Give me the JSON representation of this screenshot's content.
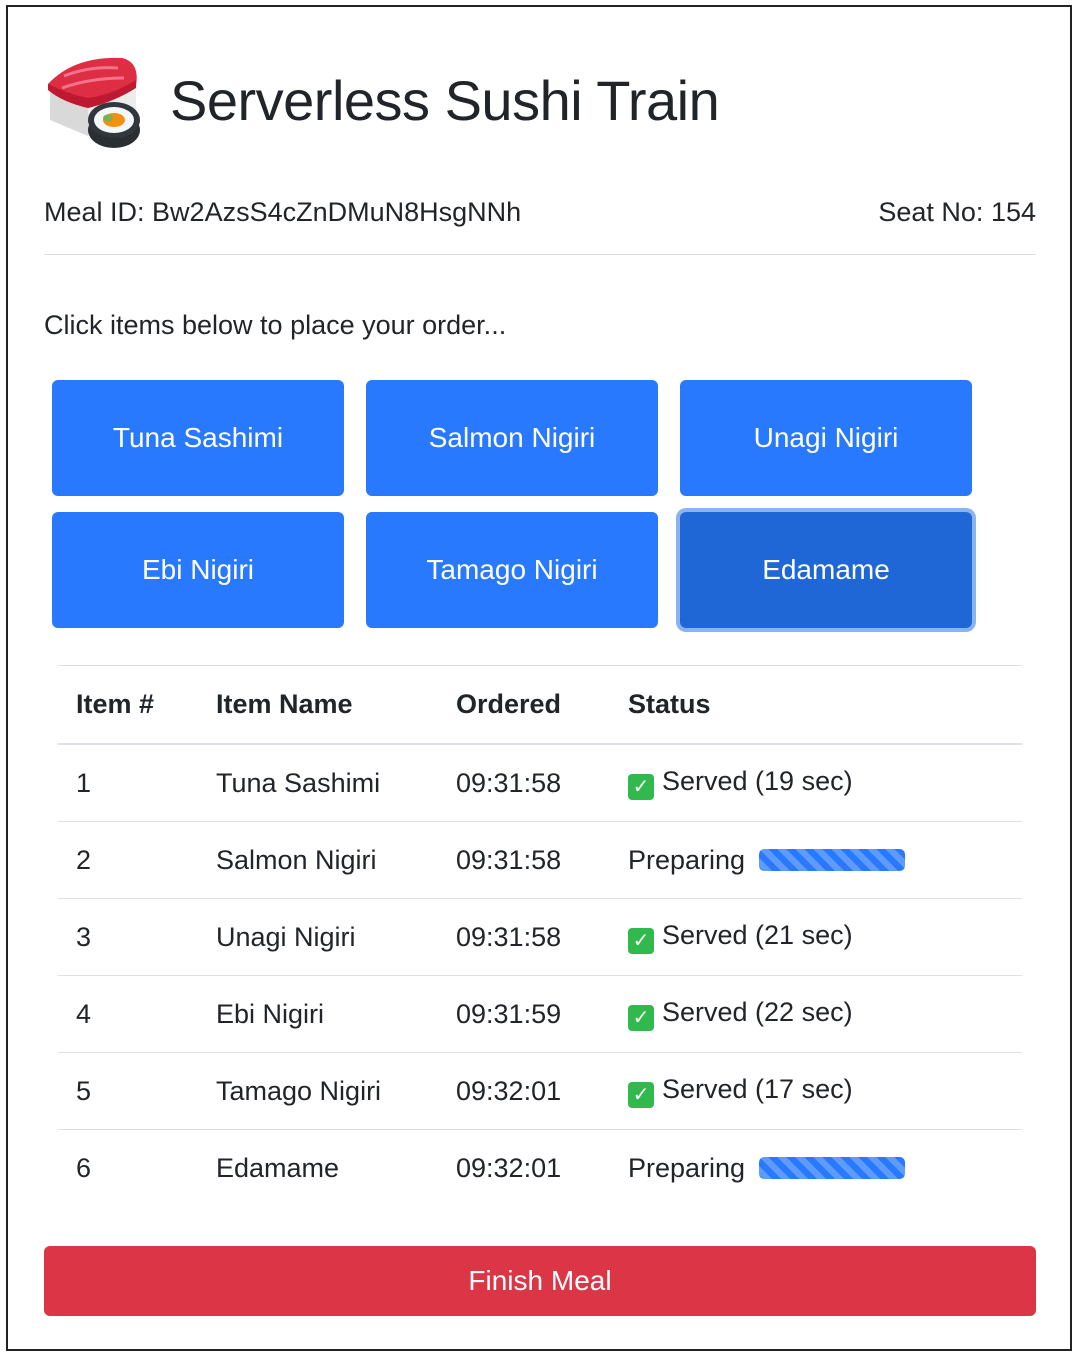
{
  "header": {
    "title": "Serverless Sushi Train",
    "logo_icon": "sushi-icon"
  },
  "meta": {
    "meal_id_label": "Meal ID:",
    "meal_id": "Bw2AzsS4cZnDMuN8HsgNNh",
    "seat_label": "Seat No:",
    "seat_no": "154"
  },
  "instruction": "Click items below to place your order...",
  "menu": {
    "items": [
      {
        "label": "Tuna Sashimi"
      },
      {
        "label": "Salmon Nigiri"
      },
      {
        "label": "Unagi Nigiri"
      },
      {
        "label": "Ebi Nigiri"
      },
      {
        "label": "Tamago Nigiri"
      },
      {
        "label": "Edamame"
      }
    ]
  },
  "orders": {
    "headers": [
      "Item #",
      "Item Name",
      "Ordered",
      "Status"
    ],
    "rows": [
      {
        "num": "1",
        "name": "Tuna Sashimi",
        "ordered": "09:31:58",
        "status": "Served (19 sec)",
        "state": "served"
      },
      {
        "num": "2",
        "name": "Salmon Nigiri",
        "ordered": "09:31:58",
        "status": "Preparing",
        "state": "preparing",
        "progress": 1.0
      },
      {
        "num": "3",
        "name": "Unagi Nigiri",
        "ordered": "09:31:58",
        "status": "Served (21 sec)",
        "state": "served"
      },
      {
        "num": "4",
        "name": "Ebi Nigiri",
        "ordered": "09:31:59",
        "status": "Served (22 sec)",
        "state": "served"
      },
      {
        "num": "5",
        "name": "Tamago Nigiri",
        "ordered": "09:32:01",
        "status": "Served (17 sec)",
        "state": "served"
      },
      {
        "num": "6",
        "name": "Edamame",
        "ordered": "09:32:01",
        "status": "Preparing",
        "state": "preparing",
        "progress": 1.0
      }
    ]
  },
  "finish_label": "Finish Meal",
  "colors": {
    "primary": "#2979ff",
    "primary_focused": "#1f66d6",
    "danger": "#dc3545",
    "served_check": "#31b94d"
  },
  "icons": {
    "served": "check-mark-button-icon"
  }
}
